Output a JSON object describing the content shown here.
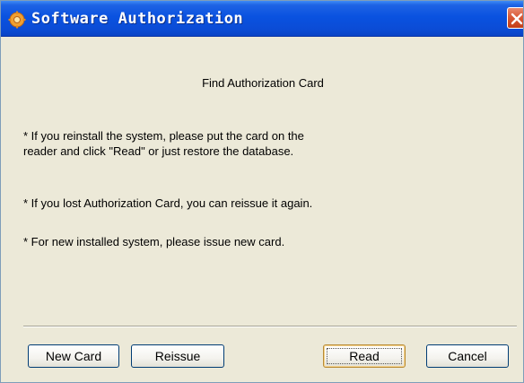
{
  "window": {
    "title": "Software Authorization",
    "app_icon": "gear-app-icon",
    "close_icon": "close-icon"
  },
  "content": {
    "heading": "Find Authorization Card",
    "paragraphs": [
      "* If you reinstall the system, please put the card on the",
      "reader and click \"Read\" or just restore the database.",
      "* If you lost Authorization Card, you can reissue it again.",
      "* For new installed system, please issue new card."
    ]
  },
  "buttons": {
    "new_card": "New Card",
    "reissue": "Reissue",
    "read": "Read",
    "cancel": "Cancel"
  },
  "colors": {
    "titlebar": "#0a52e0",
    "dialog_background": "#ece9d8",
    "close_button": "#d95a36"
  }
}
